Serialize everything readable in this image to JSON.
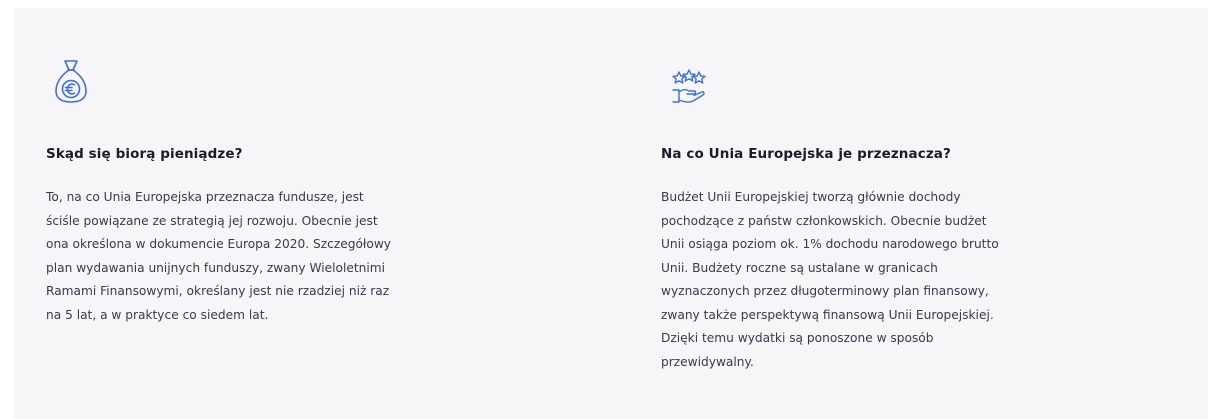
{
  "sections": [
    {
      "icon": "money-bag-euro-icon",
      "title": "Skąd się biorą pieniądze?",
      "lines": [
        "To, na co Unia Europejska przeznacza fundusze, jest",
        "ściśle powiązane ze strategią jej rozwoju. Obecnie jest",
        "ona określona w dokumencie Europa 2020. Szczegółowy",
        "plan wydawania unijnych funduszy, zwany Wieloletnimi",
        "Ramami Finansowymi, określany jest nie rzadziej niż raz",
        "na 5 lat, a w praktyce co siedem lat."
      ]
    },
    {
      "icon": "hand-with-stars-icon",
      "title": "Na co Unia Europejska je przeznacza?",
      "lines": [
        "Budżet Unii Europejskiej tworzą głównie dochody",
        "pochodzące z państw członkowskich. Obecnie budżet",
        "Unii osiąga poziom ok. 1% dochodu narodowego brutto",
        "Unii. Budżety roczne są ustalane w granicach",
        "wyznaczonych przez długoterminowy plan finansowy,",
        "zwany także perspektywą finansową Unii Europejskiej.",
        "Dzięki temu wydatki są ponoszone w sposób",
        "przewidywalny."
      ]
    }
  ],
  "colors": {
    "icon": "#3f6ee3",
    "panel_background": "#f6f6f8",
    "title": "#1b1b2b",
    "body": "#3a3a4a"
  }
}
